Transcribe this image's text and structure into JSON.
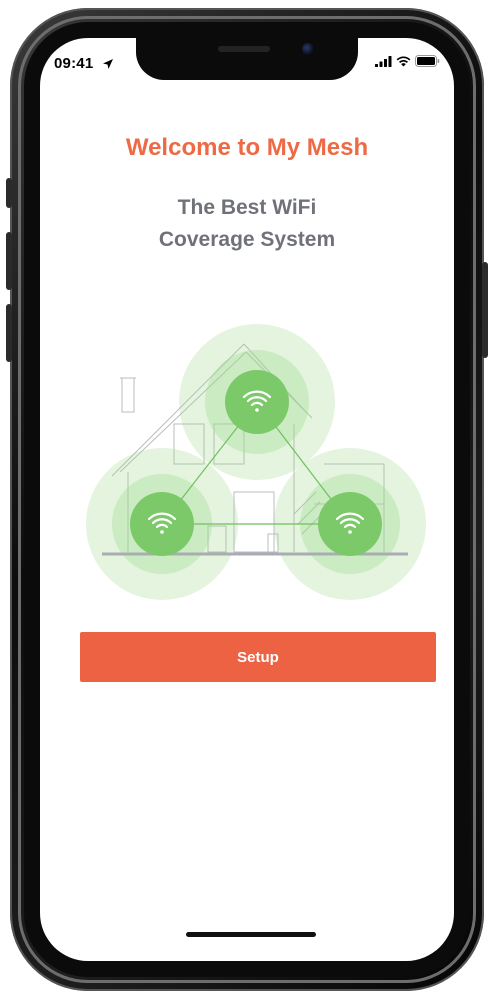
{
  "status_bar": {
    "time": "09:41",
    "icons": [
      "location-arrow-icon",
      "cellular-signal-icon",
      "wifi-icon",
      "battery-icon"
    ]
  },
  "welcome": {
    "title": "Welcome to My Mesh",
    "subtitle_line1": "The Best WiFi",
    "subtitle_line2": "Coverage System"
  },
  "illustration": {
    "nodes": [
      "wifi-node-top",
      "wifi-node-left",
      "wifi-node-right"
    ],
    "icon": "wifi-icon"
  },
  "setup_button": {
    "label": "Setup"
  },
  "colors": {
    "accent": "#ee6a45",
    "button": "#ee6244",
    "subtitle": "#6f7278",
    "coverage": "#9ed98c",
    "node": "#7cc96a"
  }
}
